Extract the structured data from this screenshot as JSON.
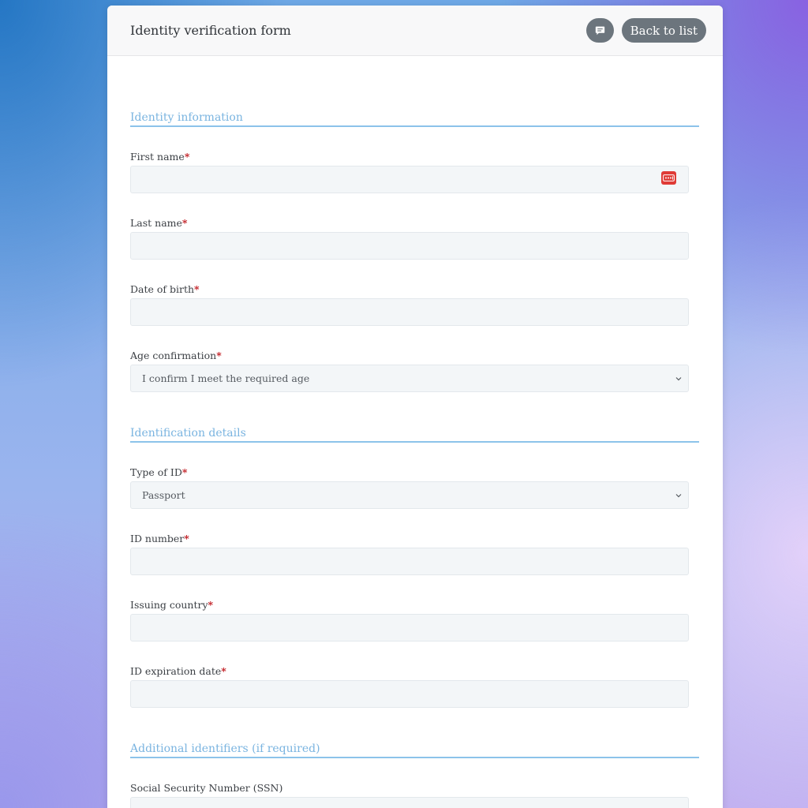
{
  "header": {
    "title": "Identity verification form",
    "back_label": "Back to list",
    "comment_icon": "comment-icon"
  },
  "sections": [
    {
      "heading": "Identity information",
      "fields": [
        {
          "label": "First name",
          "required_mark": "*",
          "value": ""
        },
        {
          "label": "Last name",
          "required_mark": "*",
          "value": ""
        },
        {
          "label": "Date of birth",
          "required_mark": "*",
          "value": ""
        },
        {
          "label": "Age confirmation",
          "required_mark": "*",
          "value": "I confirm I meet the required age"
        }
      ]
    },
    {
      "heading": "Identification details",
      "fields": [
        {
          "label": "Type of ID",
          "required_mark": "*",
          "value": "Passport"
        },
        {
          "label": "ID number",
          "required_mark": "*",
          "value": ""
        },
        {
          "label": "Issuing country",
          "required_mark": "*",
          "value": ""
        },
        {
          "label": "ID expiration date",
          "required_mark": "*",
          "value": ""
        }
      ]
    },
    {
      "heading": "Additional identifiers (if required)",
      "fields": [
        {
          "label": "Social Security Number (SSN)",
          "value": ""
        }
      ]
    }
  ],
  "colors": {
    "accent": "#7ab4e0",
    "required": "#c0181e",
    "button": "#6c757d",
    "password_manager_icon": "#df3b36"
  }
}
